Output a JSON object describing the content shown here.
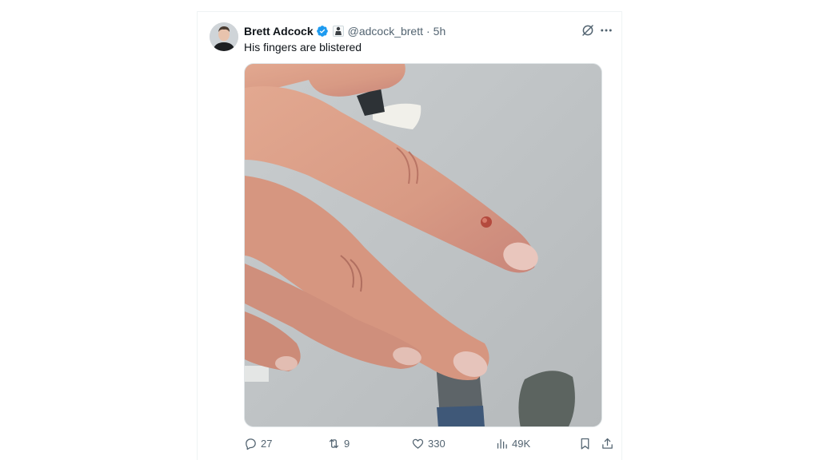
{
  "tweet": {
    "author_name": "Brett Adcock",
    "handle": "@adcock_brett",
    "separator": "·",
    "time": "5h",
    "text": "His fingers are blistered",
    "verified_color": "#1d9bf0"
  },
  "actions": {
    "replies": "27",
    "retweets": "9",
    "likes": "330",
    "views": "49K"
  },
  "icons": [
    "verified-badge-icon",
    "affiliation-badge-icon",
    "grok-icon",
    "more-icon",
    "reply-icon",
    "retweet-icon",
    "like-icon",
    "views-icon",
    "bookmark-icon",
    "share-icon"
  ]
}
